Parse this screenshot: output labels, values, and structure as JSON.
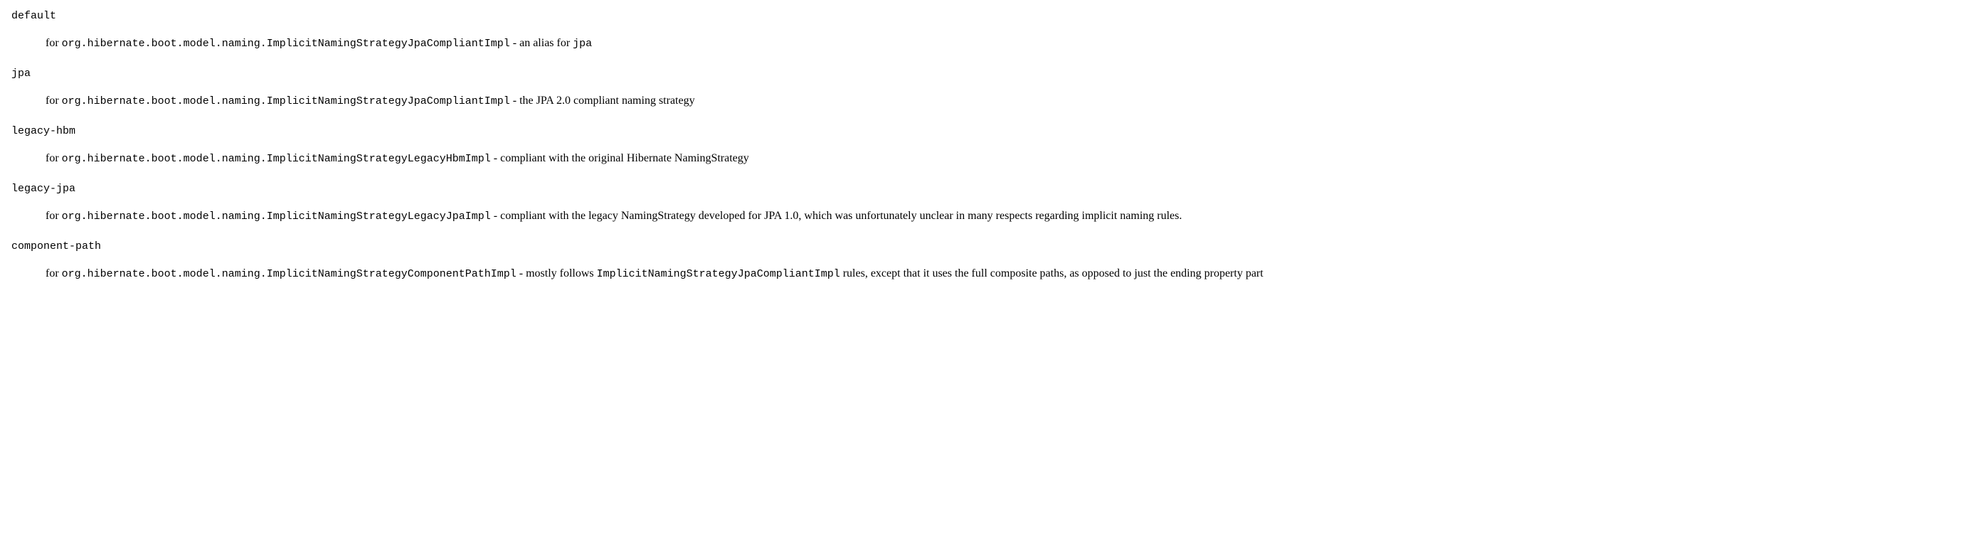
{
  "items": [
    {
      "term": "default",
      "for_word": "for ",
      "class_code": "org.hibernate.boot.model.naming.ImplicitNamingStrategyJpaCompliantImpl",
      "sep": " - ",
      "desc_pre": "an alias for ",
      "inline_code_1": "jpa",
      "desc_post": ""
    },
    {
      "term": "jpa",
      "for_word": "for ",
      "class_code": "org.hibernate.boot.model.naming.ImplicitNamingStrategyJpaCompliantImpl",
      "sep": " - ",
      "desc_pre": "the JPA 2.0 compliant naming strategy",
      "inline_code_1": "",
      "desc_post": ""
    },
    {
      "term": "legacy-hbm",
      "for_word": "for ",
      "class_code": "org.hibernate.boot.model.naming.ImplicitNamingStrategyLegacyHbmImpl",
      "sep": " - ",
      "desc_pre": "compliant with the original Hibernate NamingStrategy",
      "inline_code_1": "",
      "desc_post": ""
    },
    {
      "term": "legacy-jpa",
      "for_word": "for ",
      "class_code": "org.hibernate.boot.model.naming.ImplicitNamingStrategyLegacyJpaImpl",
      "sep": " - ",
      "desc_pre": "compliant with the legacy NamingStrategy developed for JPA 1.0, which was unfortunately unclear in many respects regarding implicit naming rules.",
      "inline_code_1": "",
      "desc_post": ""
    },
    {
      "term": "component-path",
      "for_word": "for ",
      "class_code": "org.hibernate.boot.model.naming.ImplicitNamingStrategyComponentPathImpl",
      "sep": " - ",
      "desc_pre": "mostly follows ",
      "inline_code_1": "ImplicitNamingStrategyJpaCompliantImpl",
      "desc_post": " rules, except that it uses the full composite paths, as opposed to just the ending property part"
    }
  ]
}
